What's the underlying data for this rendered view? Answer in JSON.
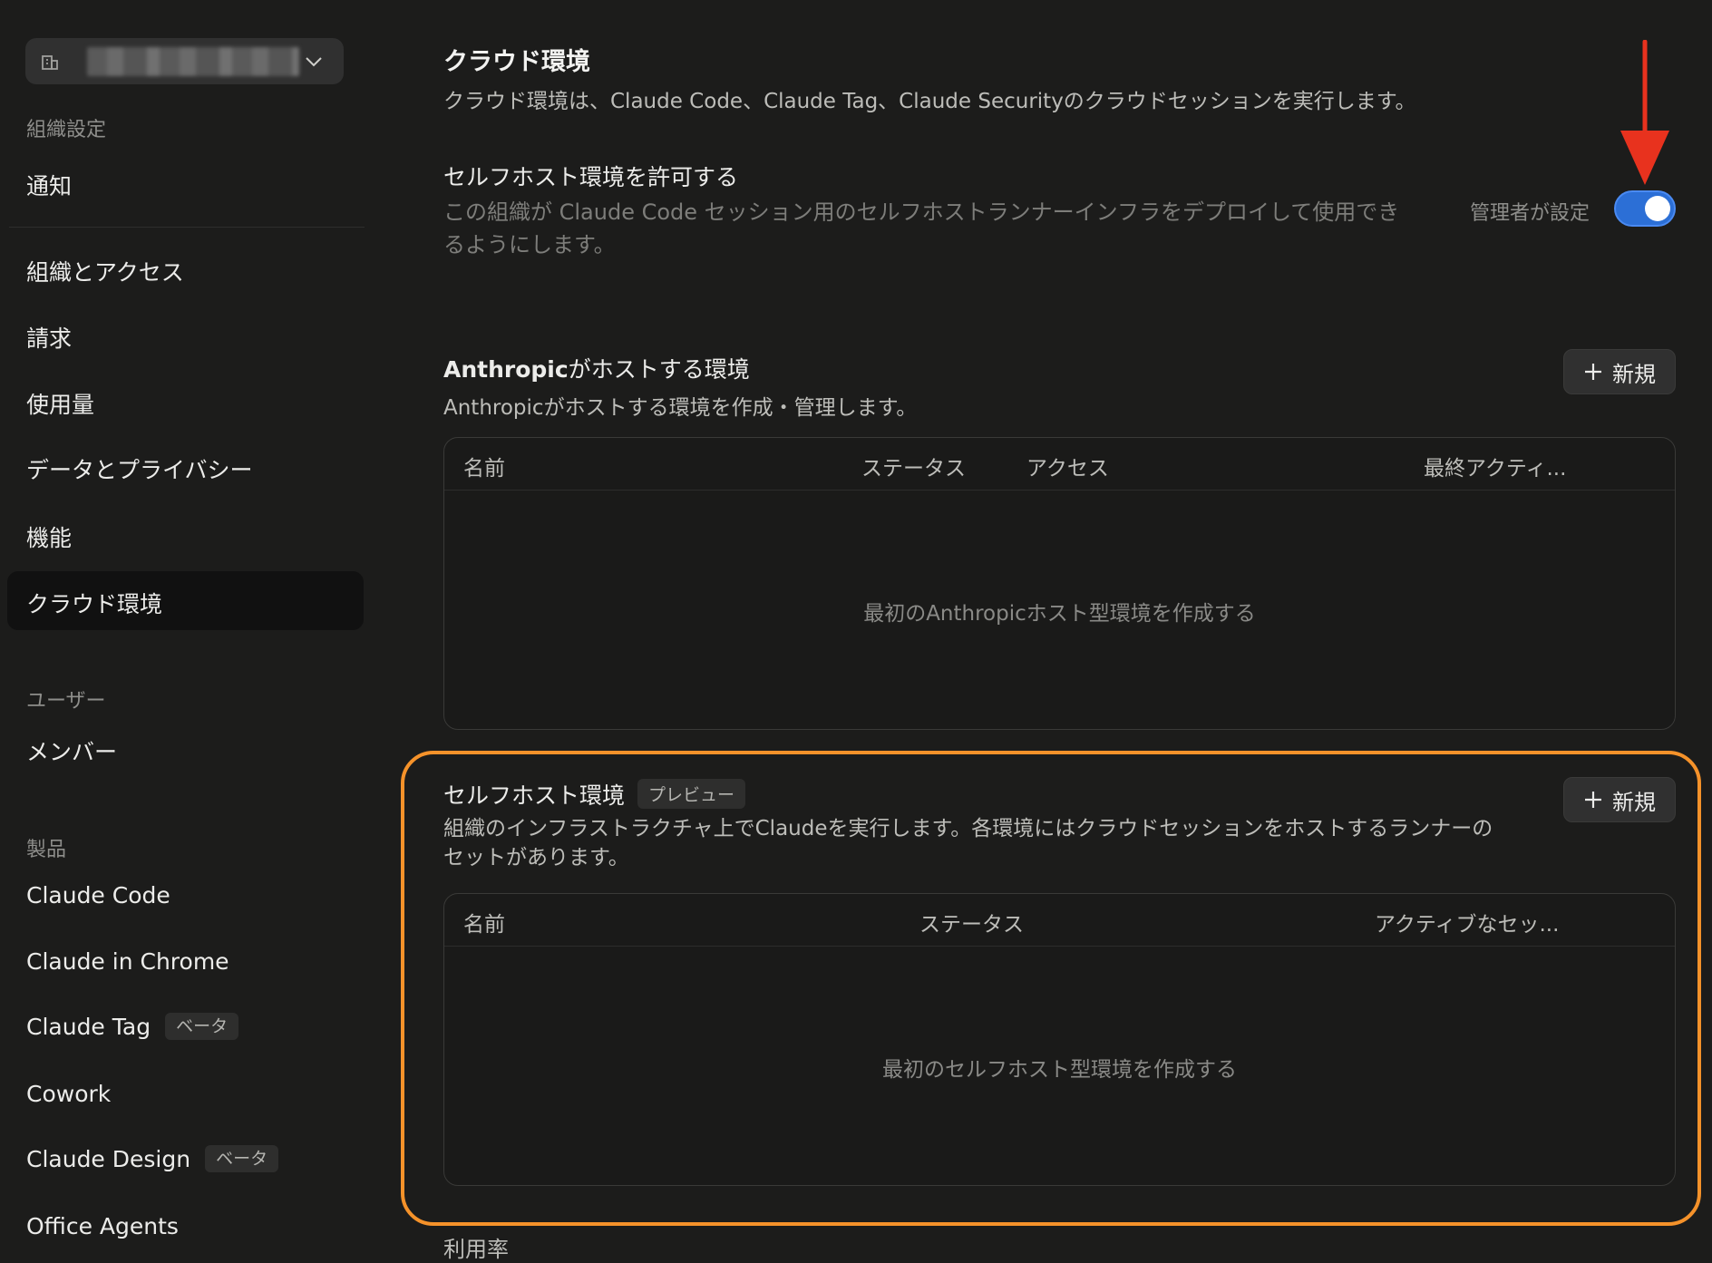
{
  "sidebar": {
    "org_switcher_name": "",
    "sections": {
      "org_settings": "組織設定",
      "users": "ユーザー",
      "products": "製品"
    },
    "items": {
      "notifications": "通知",
      "org_access": "組織とアクセス",
      "billing": "請求",
      "usage": "使用量",
      "data_privacy": "データとプライバシー",
      "features": "機能",
      "cloud_env": "クラウド環境",
      "members": "メンバー",
      "claude_code": "Claude Code",
      "claude_in_chrome": "Claude in Chrome",
      "claude_tag": "Claude Tag",
      "claude_tag_badge": "ベータ",
      "cowork": "Cowork",
      "claude_design": "Claude Design",
      "claude_design_badge": "ベータ",
      "office_agents": "Office Agents"
    },
    "active_item": "クラウド環境"
  },
  "main": {
    "title": "クラウド環境",
    "description": "クラウド環境は、Claude Code、Claude Tag、Claude Securityのクラウドセッションを実行します。",
    "self_hosted_permission": {
      "label": "セルフホスト環境を許可する",
      "description": "この組織が Claude Code セッション用のセルフホストランナーインフラをデプロイして使用できるようにします。",
      "admin_label": "管理者が設定",
      "toggle_on": true
    },
    "anthropic_hosted": {
      "title_bold": "Anthropic",
      "title_rest": "がホストする環境",
      "description": "Anthropicがホストする環境を作成・管理します。",
      "new_button": "新規",
      "columns": [
        "名前",
        "ステータス",
        "アクセス",
        "最終アクティ..."
      ],
      "empty_text": "最初のAnthropicホスト型環境を作成する"
    },
    "self_hosted": {
      "title": "セルフホスト環境",
      "badge": "プレビュー",
      "description": "組織のインフラストラクチャ上でClaudeを実行します。各環境にはクラウドセッションをホストするランナーのセットがあります。",
      "new_button": "新規",
      "columns": [
        "名前",
        "ステータス",
        "アクティブなセッ..."
      ],
      "empty_text": "最初のセルフホスト型環境を作成する"
    },
    "cut_off_heading": "利用率"
  },
  "colors": {
    "background": "#1c1c1b",
    "toggle": "#2c6fd6",
    "highlight_border": "#f5922a",
    "arrow": "#e8321e"
  }
}
